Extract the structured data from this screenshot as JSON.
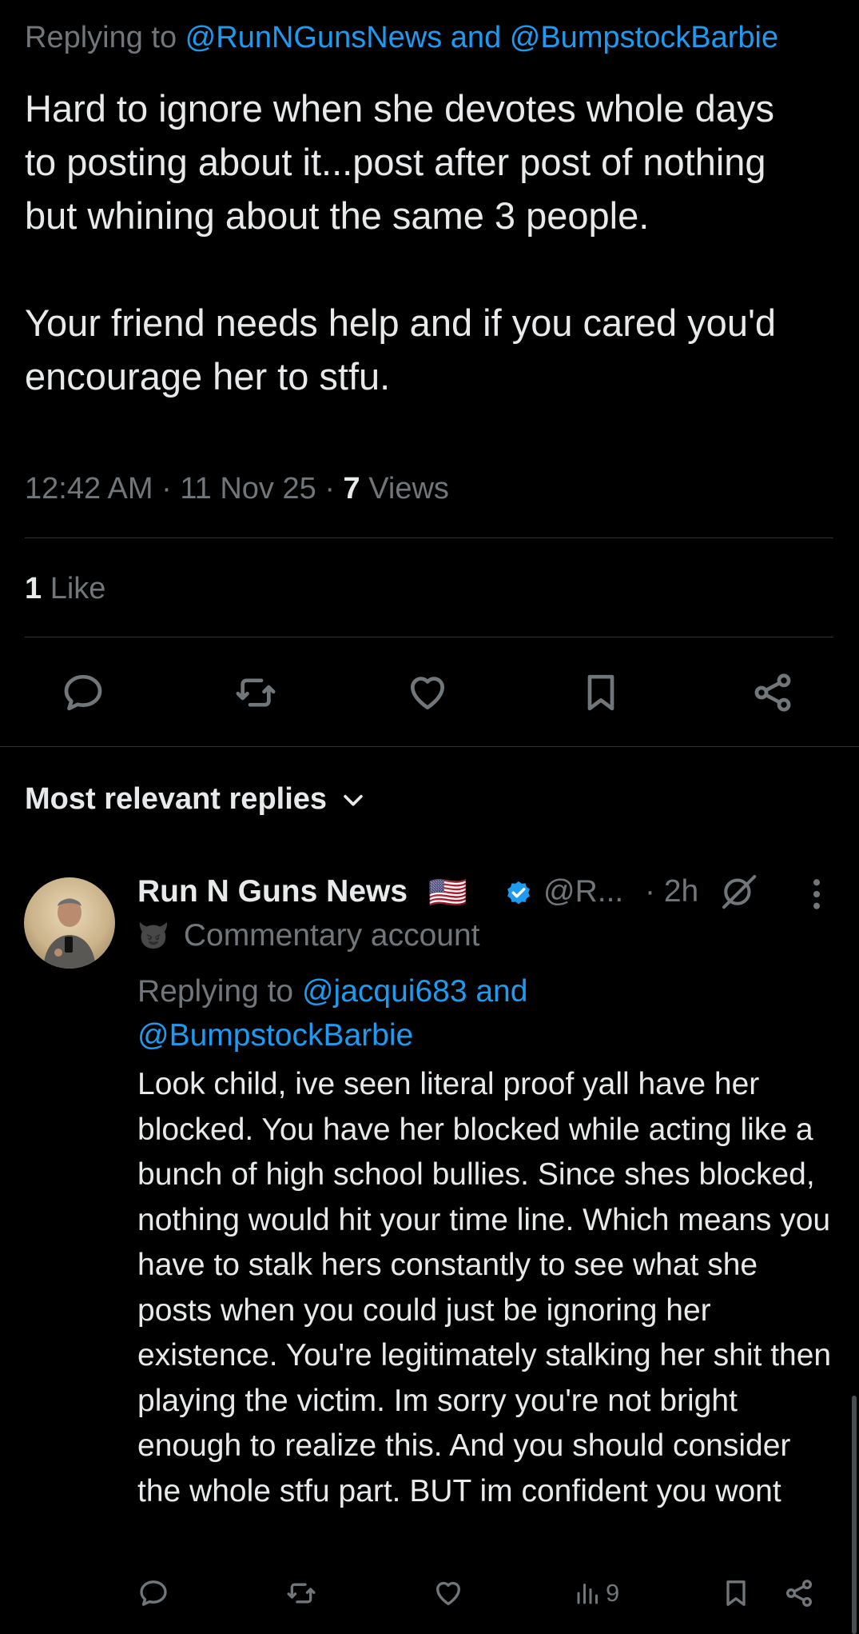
{
  "tweet": {
    "replying_prefix": "Replying to ",
    "replying_mentions": "@RunNGunsNews and @BumpstockBarbie",
    "body_paragraph_1": "Hard to ignore when she devotes whole days to posting about it...post after post of nothing but whining about the same 3 people.",
    "body_paragraph_2": "Your friend needs help and if you cared you'd encourage her to stfu.",
    "time": "12:42 AM",
    "date": "11 Nov 25",
    "dot": "·",
    "views_count": "7",
    "views_label": "Views",
    "likes_count": "1",
    "likes_label": "Like"
  },
  "replies_header": {
    "label": "Most relevant replies"
  },
  "reply": {
    "display_name": "Run N Guns News",
    "flag": "🇺🇸",
    "handle": "@R...",
    "time": "· 2h",
    "badge_label": "Commentary account",
    "badge_emoji": "😈",
    "replying_prefix": "Replying to ",
    "replying_mentions_line1": "@jacqui683 and",
    "replying_mentions_line2": "@BumpstockBarbie",
    "body": "Look child,  ive seen literal proof yall have her blocked. You have her blocked while acting like a bunch of high school bullies. Since shes blocked, nothing would hit your time line. Which means you have to stalk hers constantly to see what she posts when you could just be ignoring her existence. You're legitimately stalking her shit then playing the victim. Im sorry you're not bright enough to realize this. And you should consider the whole stfu part. BUT im confident you wont",
    "views": "9"
  },
  "icons": {
    "reply": "reply-icon",
    "retweet": "retweet-icon",
    "like": "heart-icon",
    "bookmark": "bookmark-icon",
    "share": "share-icon",
    "views": "views-icon",
    "verified": "verified-icon",
    "more": "more-icon",
    "grok": "grok-icon"
  },
  "colors": {
    "background": "#000000",
    "text": "#e7e9ea",
    "muted": "#71767b",
    "accent": "#1d9bf0",
    "separator": "#2f3336"
  }
}
